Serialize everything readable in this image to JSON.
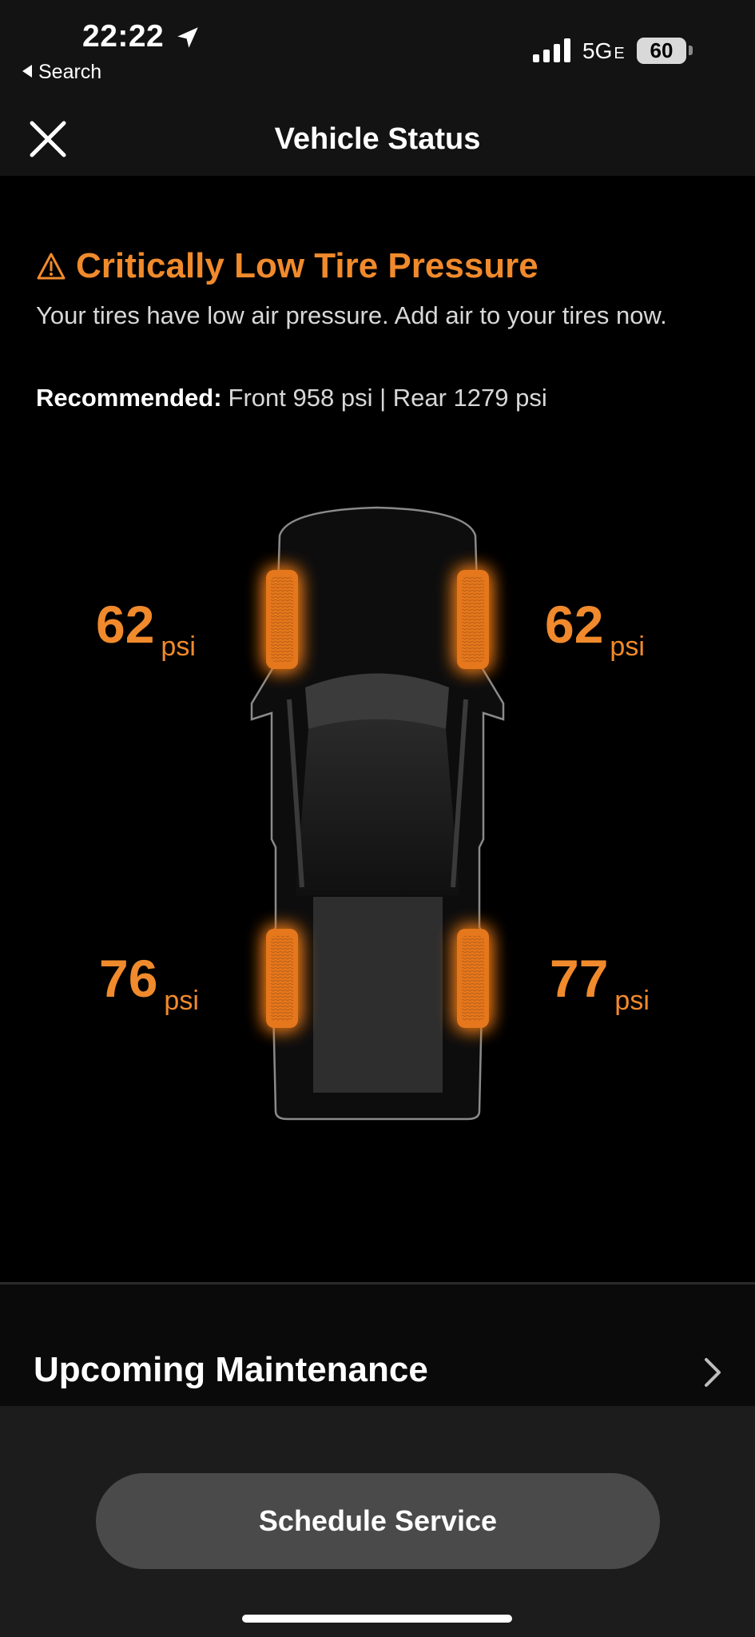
{
  "status_bar": {
    "time": "22:22",
    "back_label": "Search",
    "network": "5G",
    "network_suffix": "E",
    "battery": "60",
    "icons": [
      "location-arrow-icon",
      "signal-bars-icon",
      "battery-icon"
    ]
  },
  "nav": {
    "title": "Vehicle Status",
    "close_icon": "close-icon"
  },
  "alert": {
    "icon": "warning-triangle-icon",
    "title": "Critically Low Tire Pressure",
    "message": "Your tires have low air pressure. Add air to your tires now.",
    "recommended_label": "Recommended:",
    "recommended_value": "Front 958 psi | Rear 1279 psi",
    "color": "#f08a2c"
  },
  "tires": {
    "front_left": {
      "value": "62",
      "unit": "psi"
    },
    "front_right": {
      "value": "62",
      "unit": "psi"
    },
    "rear_left": {
      "value": "76",
      "unit": "psi"
    },
    "rear_right": {
      "value": "77",
      "unit": "psi"
    }
  },
  "maintenance": {
    "title": "Upcoming Maintenance",
    "chevron_icon": "chevron-right-icon"
  },
  "actions": {
    "schedule_service": "Schedule Service"
  }
}
